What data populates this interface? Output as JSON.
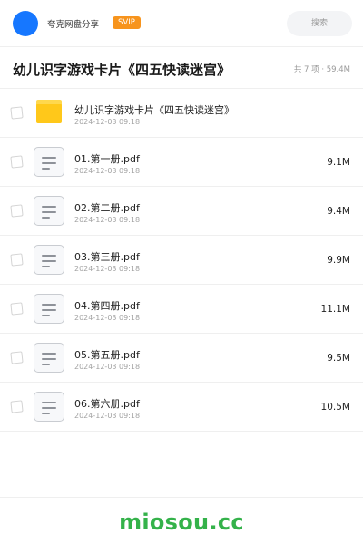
{
  "header": {
    "user_name": "夸克网盘分享",
    "badge": "SVIP",
    "search_placeholder": "搜索"
  },
  "folder": {
    "title": "幼儿识字游戏卡片《四五快读迷宫》",
    "meta": "共 7 项 · 59.4M"
  },
  "items": [
    {
      "type": "folder",
      "name": "幼儿识字游戏卡片《四五快读迷宫》",
      "date": "2024-12-03 09:18",
      "size": ""
    },
    {
      "type": "file",
      "name": "01.第一册.pdf",
      "date": "2024-12-03 09:18",
      "size": "9.1M"
    },
    {
      "type": "file",
      "name": "02.第二册.pdf",
      "date": "2024-12-03 09:18",
      "size": "9.4M"
    },
    {
      "type": "file",
      "name": "03.第三册.pdf",
      "date": "2024-12-03 09:18",
      "size": "9.9M"
    },
    {
      "type": "file",
      "name": "04.第四册.pdf",
      "date": "2024-12-03 09:18",
      "size": "11.1M"
    },
    {
      "type": "file",
      "name": "05.第五册.pdf",
      "date": "2024-12-03 09:18",
      "size": "9.5M"
    },
    {
      "type": "file",
      "name": "06.第六册.pdf",
      "date": "2024-12-03 09:18",
      "size": "10.5M"
    }
  ],
  "footer": {
    "brand": "miosou.cc"
  },
  "colors": {
    "accent": "#1677ff",
    "badge": "#f7941d",
    "folder": "#ffc81a",
    "brand": "#34b24a"
  }
}
